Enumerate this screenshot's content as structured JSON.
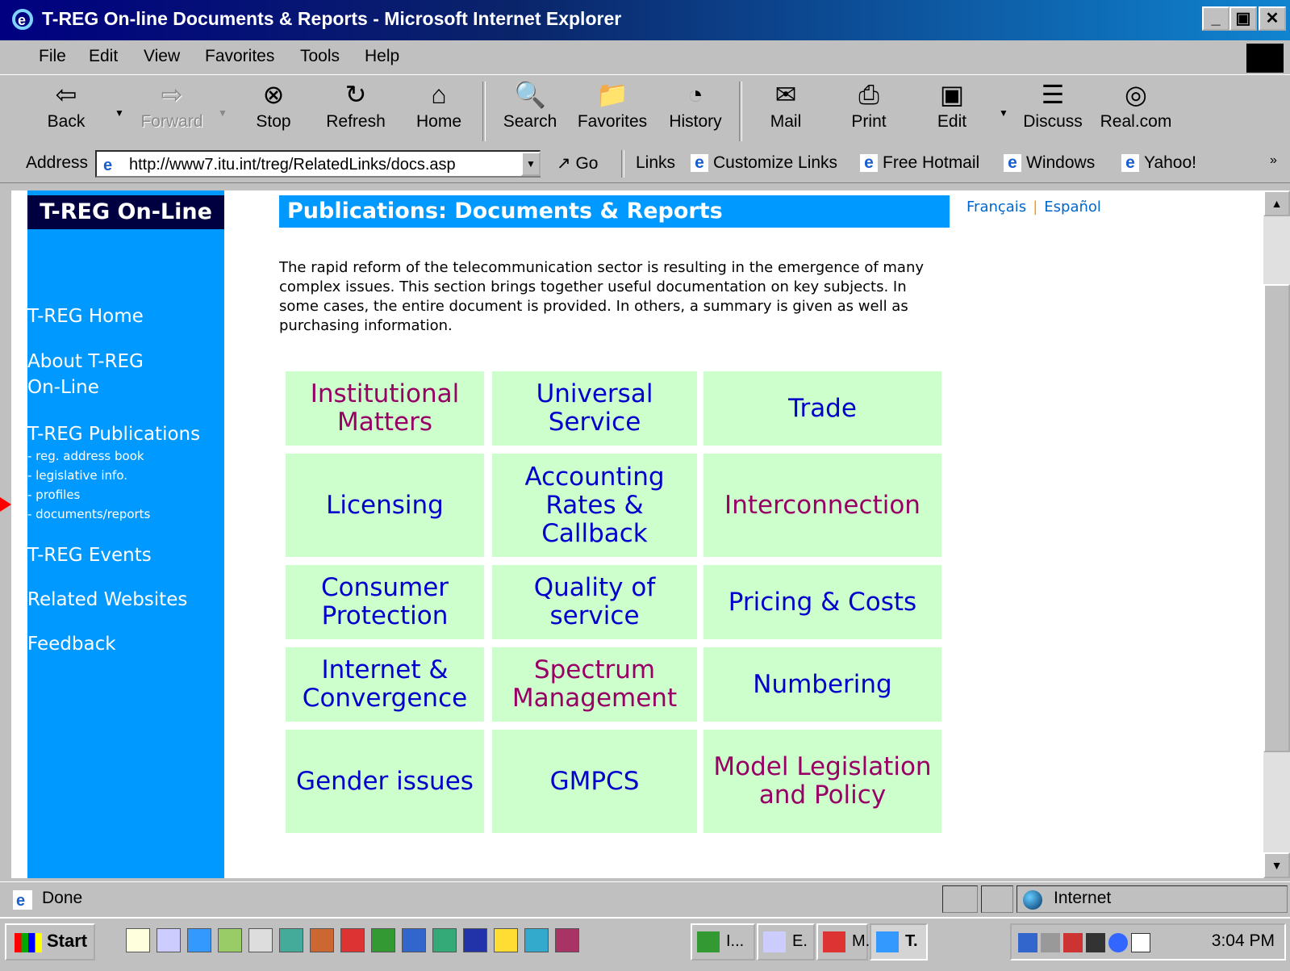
{
  "window": {
    "title": "T-REG On-line Documents & Reports - Microsoft Internet Explorer",
    "minimize": "_",
    "maximize": "▣",
    "close": "✕"
  },
  "menu": [
    "File",
    "Edit",
    "View",
    "Favorites",
    "Tools",
    "Help"
  ],
  "toolbar": {
    "back": "Back",
    "forward": "Forward",
    "stop": "Stop",
    "refresh": "Refresh",
    "home": "Home",
    "search": "Search",
    "favorites": "Favorites",
    "history": "History",
    "mail": "Mail",
    "print": "Print",
    "edit": "Edit",
    "discuss": "Discuss",
    "realcom": "Real.com"
  },
  "address": {
    "label": "Address",
    "url": "http://www7.itu.int/treg/RelatedLinks/docs.asp",
    "go": "Go",
    "links_label": "Links",
    "links": [
      "Customize Links",
      "Free Hotmail",
      "Windows",
      "Yahoo!"
    ]
  },
  "sidebar": {
    "title": "T-REG On-Line",
    "nav": [
      "T-REG Home",
      "About T-REG On-Line",
      "T-REG Publications",
      "T-REG Events",
      "Related Websites",
      "Feedback"
    ],
    "sub": [
      "- reg. address book",
      "- legislative info.",
      "- profiles",
      "- documents/reports"
    ]
  },
  "page": {
    "heading": "Publications: Documents & Reports",
    "lang_fr": "Français",
    "lang_sep": "|",
    "lang_es": "Español",
    "intro": "The rapid reform of the telecommunication sector is resulting in the emergence of many complex issues. This section brings together useful documentation on key subjects. In some cases, the entire document is provided. In others, a summary is given as well as purchasing information."
  },
  "topics": [
    {
      "label": "Institutional Matters",
      "visited": true
    },
    {
      "label": "Universal Service",
      "visited": false
    },
    {
      "label": "Trade",
      "visited": false
    },
    {
      "label": "Licensing",
      "visited": false
    },
    {
      "label": "Accounting Rates & Callback",
      "visited": false
    },
    {
      "label": "Interconnection",
      "visited": true
    },
    {
      "label": "Consumer Protection",
      "visited": false
    },
    {
      "label": "Quality of service",
      "visited": false
    },
    {
      "label": "Pricing & Costs",
      "visited": false
    },
    {
      "label": "Internet & Convergence",
      "visited": false
    },
    {
      "label": "Spectrum Management",
      "visited": true
    },
    {
      "label": "Numbering",
      "visited": false
    },
    {
      "label": "Gender issues",
      "visited": false
    },
    {
      "label": "GMPCS",
      "visited": false
    },
    {
      "label": "Model Legislation and Policy",
      "visited": true
    }
  ],
  "status": {
    "text": "Done",
    "zone": "Internet"
  },
  "taskbar": {
    "start": "Start",
    "tasks": [
      "I...",
      "E.",
      "M.",
      "T."
    ],
    "clock": "3:04 PM"
  },
  "colors": {
    "sidebar": "#0099ff",
    "topic_bg": "#ccffcc",
    "link": "#0000cc",
    "visited": "#990066"
  }
}
